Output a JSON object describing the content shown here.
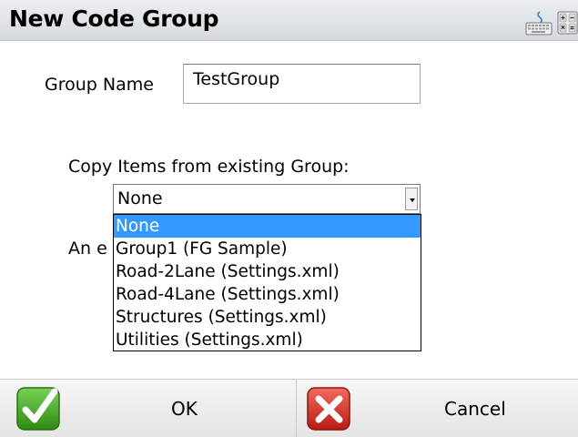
{
  "dialog": {
    "title": "New Code Group",
    "keyboard_icon": "keyboard-icon",
    "calculator_icon": "calculator-icon"
  },
  "form": {
    "group_name_label": "Group Name",
    "group_name_value": "TestGroup",
    "copy_label": "Copy Items from existing Group:",
    "copy_selected": "None",
    "partial_text": "An e"
  },
  "dropdown": {
    "options": [
      "None",
      "Group1 (FG Sample)",
      "Road-2Lane (Settings.xml)",
      "Road-4Lane (Settings.xml)",
      "Structures (Settings.xml)",
      "Utilities (Settings.xml)"
    ],
    "highlighted": "None"
  },
  "buttons": {
    "ok_label": "OK",
    "ok_icon": "checkmark-icon",
    "cancel_label": "Cancel",
    "cancel_icon": "close-x-icon"
  },
  "colors": {
    "highlight": "#3399ff",
    "ok_green": "#3a9a1a",
    "cancel_red": "#d42a20"
  }
}
